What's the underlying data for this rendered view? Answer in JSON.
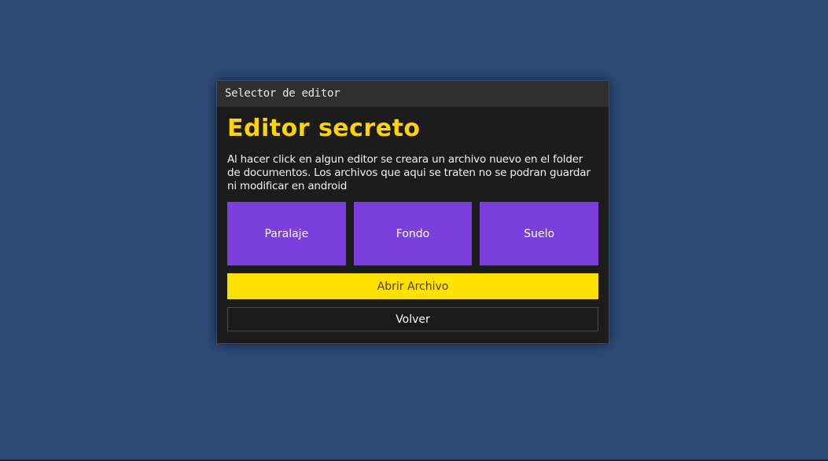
{
  "dialog": {
    "title": "Selector de editor",
    "heading": "Editor secreto",
    "description": "Al hacer click en algun editor se creara un archivo nuevo en el folder de documentos. Los archivos que aqui se traten no se podran guardar ni modificar en android",
    "editors": [
      {
        "label": "Paralaje"
      },
      {
        "label": "Fondo"
      },
      {
        "label": "Suelo"
      }
    ],
    "open_label": "Abrir Archivo",
    "back_label": "Volver"
  },
  "colors": {
    "background": "#2e4b78",
    "panel": "#1c1c1c",
    "titlebar": "#303030",
    "heading": "#ffd400",
    "editor_button": "#7a3fdd",
    "open_button": "#ffe100"
  }
}
